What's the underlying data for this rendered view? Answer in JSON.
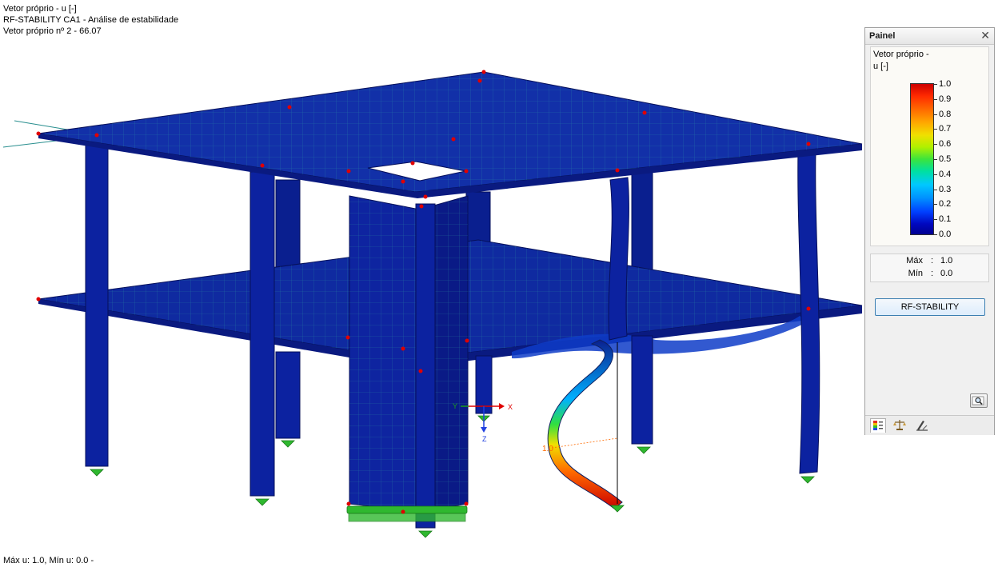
{
  "overlay": {
    "line1": "Vetor próprio - u [-]",
    "line2": "RF-STABILITY CA1 - Análise de estabilidade",
    "line3": "Vetor próprio nº 2  -  66.07"
  },
  "footer": {
    "text": "Máx u: 1.0, Mín u: 0.0 -"
  },
  "axes": {
    "x": "X",
    "y": "Y",
    "z": "Z"
  },
  "member_label": "1.0",
  "panel": {
    "title": "Painel",
    "close_icon": "close-icon",
    "legend": {
      "label1": "Vetor próprio -",
      "label2": "u [-]",
      "ticks": [
        "1.0",
        "0.9",
        "0.8",
        "0.7",
        "0.6",
        "0.5",
        "0.4",
        "0.3",
        "0.2",
        "0.1",
        "0.0"
      ]
    },
    "max_label": "Máx",
    "max_value": "1.0",
    "min_label": "Mín",
    "min_value": "0.0",
    "button_label": "RF-STABILITY",
    "zoom_icon": "magnifier-icon",
    "tabs": [
      "color-scale-icon",
      "balance-icon",
      "drawing-tools-icon"
    ]
  },
  "colors": {
    "structure": "#0a1f8f",
    "mesh": "#2fa3a3",
    "support": "#2fb82f",
    "node": "#e00000",
    "panel_bg": "#f0f0f0",
    "button_border": "#3c7fb1"
  }
}
